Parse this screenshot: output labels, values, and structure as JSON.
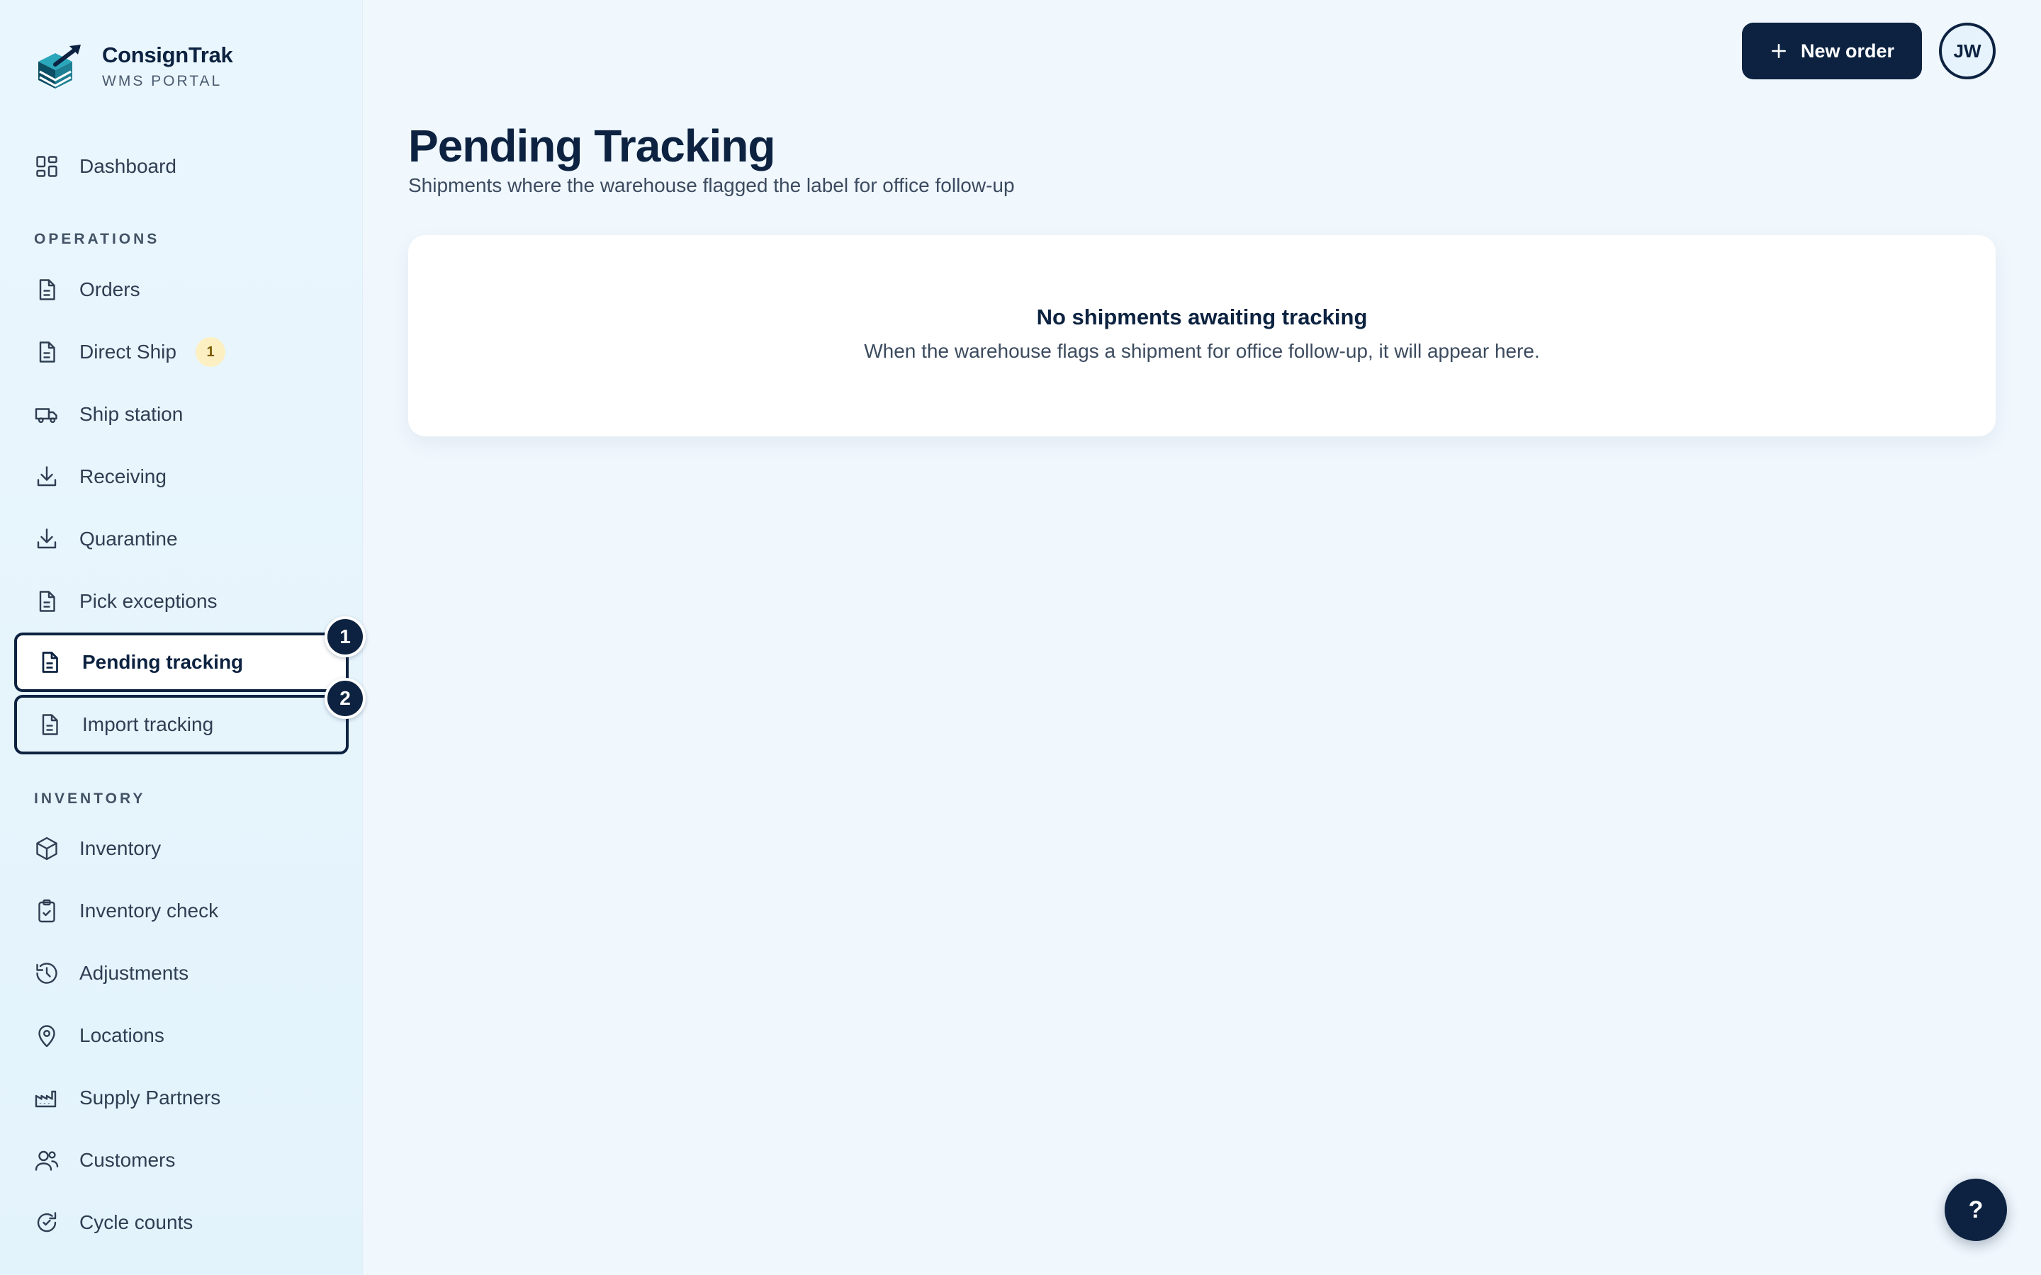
{
  "brand": {
    "name": "ConsignTrak",
    "subtitle": "WMS PORTAL"
  },
  "sidebar": {
    "dashboard": {
      "label": "Dashboard",
      "icon": "dashboard-icon"
    },
    "sections": {
      "operations": "OPERATIONS",
      "inventory": "INVENTORY"
    },
    "operations": [
      {
        "label": "Orders",
        "icon": "document-icon"
      },
      {
        "label": "Direct Ship",
        "icon": "document-icon",
        "badge": "1"
      },
      {
        "label": "Ship station",
        "icon": "truck-icon"
      },
      {
        "label": "Receiving",
        "icon": "download-icon"
      },
      {
        "label": "Quarantine",
        "icon": "download-icon"
      },
      {
        "label": "Pick exceptions",
        "icon": "document-icon"
      },
      {
        "label": "Pending tracking",
        "icon": "document-icon",
        "active": true
      },
      {
        "label": "Import tracking",
        "icon": "document-icon"
      }
    ],
    "inventory": [
      {
        "label": "Inventory",
        "icon": "cube-icon"
      },
      {
        "label": "Inventory check",
        "icon": "clipboard-check-icon"
      },
      {
        "label": "Adjustments",
        "icon": "history-icon"
      },
      {
        "label": "Locations",
        "icon": "map-pin-icon"
      },
      {
        "label": "Supply Partners",
        "icon": "factory-icon"
      },
      {
        "label": "Customers",
        "icon": "users-icon"
      },
      {
        "label": "Cycle counts",
        "icon": "refresh-check-icon"
      }
    ]
  },
  "markers": [
    "1",
    "2"
  ],
  "header": {
    "new_order_label": "New order",
    "avatar_initials": "JW"
  },
  "page": {
    "title": "Pending Tracking",
    "subtitle": "Shipments where the warehouse flagged the label for office follow-up"
  },
  "empty_state": {
    "title": "No shipments awaiting tracking",
    "text": "When the warehouse flags a shipment for office follow-up, it will appear here."
  },
  "help": {
    "label": "?"
  },
  "colors": {
    "primary": "#0c2240",
    "background": "#f0f7fd",
    "sidebar": "#e7f5fd",
    "badge_bg": "#fcf0c2",
    "logo_teal": "#1f8ea3"
  }
}
